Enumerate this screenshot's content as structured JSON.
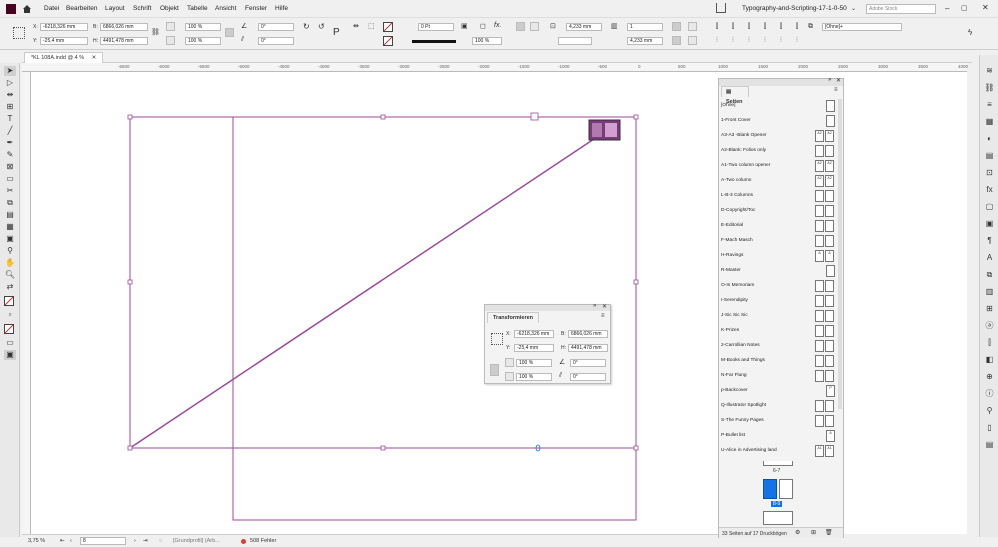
{
  "menu": {
    "items": [
      "Datei",
      "Bearbeiten",
      "Layout",
      "Schrift",
      "Objekt",
      "Tabelle",
      "Ansicht",
      "Fenster",
      "Hilfe"
    ],
    "doc_title": "Typography-and-Scripting-17-1-0-50",
    "search_placeholder": "Adobe Stock"
  },
  "control": {
    "x_label": "X:",
    "x_value": "-6218,326 mm",
    "y_label": "Y:",
    "y_value": "-25,4 mm",
    "b_label": "B:",
    "b_value": "6866,026 mm",
    "h_label": "H:",
    "h_value": "4491,478 mm",
    "scale_x": "100 %",
    "scale_y": "100 %",
    "angle": "0°",
    "shear": "0°",
    "stroke_weight": "0 Pt",
    "opacity": "100 %",
    "offset_1": "4,233 mm",
    "offset_2": "4,233 mm",
    "columns": "1",
    "object_style": "[Ohne]+"
  },
  "tab": {
    "label": "*KL 108A.indd @ 4 %"
  },
  "ruler_ticks": [
    "-6500",
    "-6000",
    "-5500",
    "-5000",
    "-4500",
    "-4000",
    "-3500",
    "-3000",
    "-2500",
    "-2000",
    "-1500",
    "-1000",
    "-500",
    "0",
    "500",
    "1000",
    "1500",
    "2000",
    "2500",
    "3000",
    "3500",
    "4000",
    "4500"
  ],
  "pages_panel": {
    "title": "Seiten",
    "masters": [
      {
        "name": "[Ohne]",
        "thumbs": [
          ""
        ]
      },
      {
        "name": "1-Front Cover",
        "thumbs": [
          ""
        ]
      },
      {
        "name": "A3-A3 -Blank Opener",
        "thumbs": [
          "A2",
          "A2"
        ]
      },
      {
        "name": "A2-Blank: Folios only",
        "thumbs": [
          "",
          ""
        ]
      },
      {
        "name": "A1-Two column opener",
        "thumbs": [
          "A2",
          "A2"
        ]
      },
      {
        "name": "A-Two column",
        "thumbs": [
          "A2",
          "A2"
        ]
      },
      {
        "name": "L-B-3 Columns",
        "thumbs": [
          "",
          ""
        ]
      },
      {
        "name": "D-Copyright/Toc",
        "thumbs": [
          "",
          ""
        ]
      },
      {
        "name": "E-Editorial",
        "thumbs": [
          "",
          ""
        ]
      },
      {
        "name": "F-Mach Masch",
        "thumbs": [
          "",
          ""
        ]
      },
      {
        "name": "H-Ravings",
        "thumbs": [
          "A",
          "A"
        ]
      },
      {
        "name": "R-Master",
        "thumbs": [
          ""
        ]
      },
      {
        "name": "O-In Memoriam",
        "thumbs": [
          "",
          ""
        ]
      },
      {
        "name": "I-Serendipity",
        "thumbs": [
          "",
          ""
        ]
      },
      {
        "name": "J-Sic Sic Sic",
        "thumbs": [
          "",
          ""
        ]
      },
      {
        "name": "K-Prizes",
        "thumbs": [
          "",
          ""
        ]
      },
      {
        "name": "2-Carrollian Notes",
        "thumbs": [
          "",
          ""
        ]
      },
      {
        "name": "M-Books and Things",
        "thumbs": [
          "",
          ""
        ]
      },
      {
        "name": "N-Far Flung",
        "thumbs": [
          "",
          ""
        ]
      },
      {
        "name": "p-Backcover",
        "thumbs": [
          "P"
        ]
      },
      {
        "name": "Q-Illustrator Spotlight",
        "thumbs": [
          "",
          ""
        ]
      },
      {
        "name": "S-The Funny Pages",
        "thumbs": [
          "",
          ""
        ]
      },
      {
        "name": "P-Bullet list",
        "thumbs": [
          "A"
        ]
      },
      {
        "name": "U-Alice in Advertising land",
        "thumbs": [
          "A1",
          "A1"
        ]
      }
    ],
    "spread_label_1": "6-7",
    "spread_label_2": "8-9",
    "footer": "33 Seiten auf 17 Druckbögen"
  },
  "transform_panel": {
    "title": "Transformieren",
    "x_label": "X:",
    "x_value": "-6218,326 mm",
    "y_label": "Y:",
    "y_value": "-25,4 mm",
    "b_label": "B:",
    "b_value": "6866,026 mm",
    "h_label": "H:",
    "h_value": "4491,478 mm",
    "scale_x": "100 %",
    "scale_y": "100 %",
    "angle": "0°",
    "shear": "0°"
  },
  "status": {
    "zoom": "3,75 %",
    "page": "8",
    "profile": "[Grundprofil] (Arb...",
    "errors": "508 Fehler"
  },
  "colors": {
    "frame": "#9c4a9c",
    "accent": "#1473e6",
    "error": "#e03c31"
  }
}
